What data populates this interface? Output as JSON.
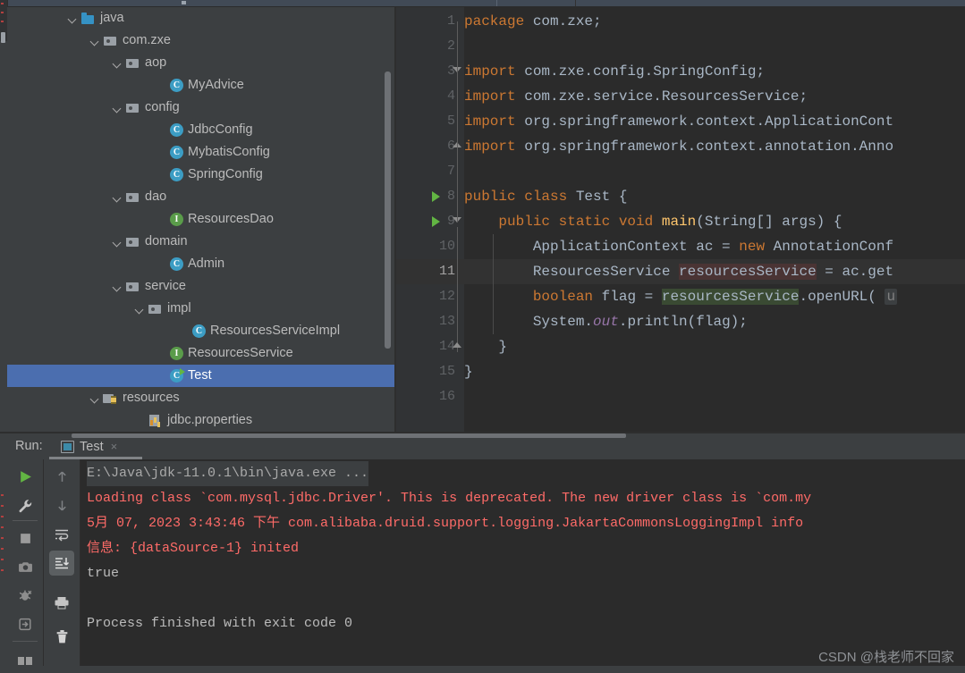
{
  "window": {
    "watermark": "CSDN @栈老师不回家"
  },
  "project_tree": {
    "name": "Project",
    "items": [
      {
        "label": "java",
        "indent": 0,
        "icon": "folder-source-icon",
        "arrow": "expanded",
        "selected": false
      },
      {
        "label": "com.zxe",
        "indent": 1,
        "icon": "package-folder-icon",
        "arrow": "expanded",
        "selected": false
      },
      {
        "label": "aop",
        "indent": 2,
        "icon": "package-folder-icon",
        "arrow": "expanded",
        "selected": false
      },
      {
        "label": "MyAdvice",
        "indent": 4,
        "icon": "java-class-icon",
        "arrow": "none",
        "selected": false
      },
      {
        "label": "config",
        "indent": 2,
        "icon": "package-folder-icon",
        "arrow": "expanded",
        "selected": false
      },
      {
        "label": "JdbcConfig",
        "indent": 4,
        "icon": "java-class-icon",
        "arrow": "none",
        "selected": false
      },
      {
        "label": "MybatisConfig",
        "indent": 4,
        "icon": "java-class-icon",
        "arrow": "none",
        "selected": false
      },
      {
        "label": "SpringConfig",
        "indent": 4,
        "icon": "java-class-icon",
        "arrow": "none",
        "selected": false
      },
      {
        "label": "dao",
        "indent": 2,
        "icon": "package-folder-icon",
        "arrow": "expanded",
        "selected": false
      },
      {
        "label": "ResourcesDao",
        "indent": 4,
        "icon": "java-interface-icon",
        "arrow": "none",
        "selected": false
      },
      {
        "label": "domain",
        "indent": 2,
        "icon": "package-folder-icon",
        "arrow": "expanded",
        "selected": false
      },
      {
        "label": "Admin",
        "indent": 4,
        "icon": "java-class-icon",
        "arrow": "none",
        "selected": false
      },
      {
        "label": "service",
        "indent": 2,
        "icon": "package-folder-icon",
        "arrow": "expanded",
        "selected": false
      },
      {
        "label": "impl",
        "indent": 3,
        "icon": "package-folder-icon",
        "arrow": "expanded",
        "selected": false
      },
      {
        "label": "ResourcesServiceImpl",
        "indent": 5,
        "icon": "java-class-icon",
        "arrow": "none",
        "selected": false
      },
      {
        "label": "ResourcesService",
        "indent": 4,
        "icon": "java-interface-icon",
        "arrow": "none",
        "selected": false
      },
      {
        "label": "Test",
        "indent": 4,
        "icon": "java-runnable-class-icon",
        "arrow": "none",
        "selected": true
      },
      {
        "label": "resources",
        "indent": 1,
        "icon": "resources-folder-icon",
        "arrow": "expanded",
        "selected": false
      },
      {
        "label": "jdbc.properties",
        "indent": 3,
        "icon": "properties-file-icon",
        "arrow": "none",
        "selected": false
      }
    ]
  },
  "editor": {
    "file": "Test.java",
    "current_line": 11,
    "line_numbers": [
      1,
      2,
      3,
      4,
      5,
      6,
      7,
      8,
      9,
      10,
      11,
      12,
      13,
      14,
      15,
      16
    ],
    "run_gutter_lines": [
      8,
      9
    ],
    "lines": [
      {
        "n": 1,
        "segments": [
          {
            "t": "package",
            "c": "k"
          },
          {
            "t": " com.zxe;",
            "c": "t"
          }
        ]
      },
      {
        "n": 2,
        "segments": []
      },
      {
        "n": 3,
        "segments": [
          {
            "t": "import",
            "c": "k"
          },
          {
            "t": " com.zxe.config.SpringConfig;",
            "c": "t"
          }
        ]
      },
      {
        "n": 4,
        "segments": [
          {
            "t": "import",
            "c": "k"
          },
          {
            "t": " com.zxe.service.ResourcesService;",
            "c": "t"
          }
        ]
      },
      {
        "n": 5,
        "segments": [
          {
            "t": "import",
            "c": "k"
          },
          {
            "t": " org.springframework.context.ApplicationCont",
            "c": "t"
          }
        ]
      },
      {
        "n": 6,
        "segments": [
          {
            "t": "import",
            "c": "k"
          },
          {
            "t": " org.springframework.context.annotation.Anno",
            "c": "t"
          }
        ]
      },
      {
        "n": 7,
        "segments": []
      },
      {
        "n": 8,
        "segments": [
          {
            "t": "public class",
            "c": "k"
          },
          {
            "t": " Test {",
            "c": "t"
          }
        ]
      },
      {
        "n": 9,
        "segments": [
          {
            "t": "    ",
            "c": "t"
          },
          {
            "t": "public static void",
            "c": "k"
          },
          {
            "t": " ",
            "c": "t"
          },
          {
            "t": "main",
            "c": "m"
          },
          {
            "t": "(String[] args) {",
            "c": "t"
          }
        ]
      },
      {
        "n": 10,
        "segments": [
          {
            "t": "        ApplicationContext ac = ",
            "c": "t"
          },
          {
            "t": "new",
            "c": "k"
          },
          {
            "t": " AnnotationConf",
            "c": "t"
          }
        ]
      },
      {
        "n": 11,
        "segments": [
          {
            "t": "        ResourcesService ",
            "c": "t"
          },
          {
            "t": "resourcesService",
            "c": "t sel-brown"
          },
          {
            "t": " = ac.get",
            "c": "t"
          }
        ]
      },
      {
        "n": 12,
        "segments": [
          {
            "t": "        ",
            "c": "t"
          },
          {
            "t": "boolean",
            "c": "k"
          },
          {
            "t": " flag = ",
            "c": "t"
          },
          {
            "t": "resourcesService",
            "c": "t sel-green"
          },
          {
            "t": ".openURL( ",
            "c": "t"
          },
          {
            "t": "u",
            "c": "hint"
          }
        ]
      },
      {
        "n": 13,
        "segments": [
          {
            "t": "        System.",
            "c": "t"
          },
          {
            "t": "out",
            "c": "f"
          },
          {
            "t": ".println(flag);",
            "c": "t"
          }
        ]
      },
      {
        "n": 14,
        "segments": [
          {
            "t": "    }",
            "c": "t"
          }
        ]
      },
      {
        "n": 15,
        "segments": [
          {
            "t": "}",
            "c": "t"
          }
        ]
      },
      {
        "n": 16,
        "segments": []
      }
    ]
  },
  "run_panel": {
    "label": "Run:",
    "tab_name": "Test",
    "close_label": "×",
    "toolbar_left": [
      {
        "name": "rerun-button",
        "glyph": "play"
      },
      {
        "name": "edit-configurations-button",
        "glyph": "wrench"
      },
      {
        "name": "stop-button",
        "glyph": "stop"
      },
      {
        "name": "screenshot-button",
        "glyph": "camera"
      },
      {
        "name": "dump-threads-button",
        "glyph": "bug"
      },
      {
        "name": "resume-button",
        "glyph": "enter"
      },
      {
        "name": "layout-button",
        "glyph": "layout"
      }
    ],
    "toolbar_right": [
      {
        "name": "previous-occurrence-button",
        "glyph": "arrow-up"
      },
      {
        "name": "next-occurrence-button",
        "glyph": "arrow-down"
      },
      {
        "name": "soft-wrap-button",
        "glyph": "wrap"
      },
      {
        "name": "scroll-to-end-button",
        "glyph": "scroll-end",
        "active": true
      },
      {
        "name": "print-button",
        "glyph": "printer"
      },
      {
        "name": "clear-all-button",
        "glyph": "trash"
      }
    ],
    "console_lines": [
      {
        "text": "E:\\Java\\jdk-11.0.1\\bin\\java.exe ...",
        "style": "grey"
      },
      {
        "text": "Loading class `com.mysql.jdbc.Driver'. This is deprecated. The new driver class is `com.my",
        "style": "red"
      },
      {
        "text": "5月 07, 2023 3:43:46 下午 com.alibaba.druid.support.logging.JakartaCommonsLoggingImpl info",
        "style": "red"
      },
      {
        "text": "信息: {dataSource-1} inited",
        "style": "red"
      },
      {
        "text": "true",
        "style": "white"
      },
      {
        "text": "",
        "style": "white"
      },
      {
        "text": "Process finished with exit code 0",
        "style": "white"
      }
    ]
  },
  "colors": {
    "background": "#3c3f41",
    "editor_background": "#2b2b2b",
    "selection_blue": "#4b6eaf",
    "keyword_orange": "#cc7832",
    "text_grey": "#a9b7c6",
    "error_red": "#ff6b68",
    "run_green": "#62b543"
  }
}
